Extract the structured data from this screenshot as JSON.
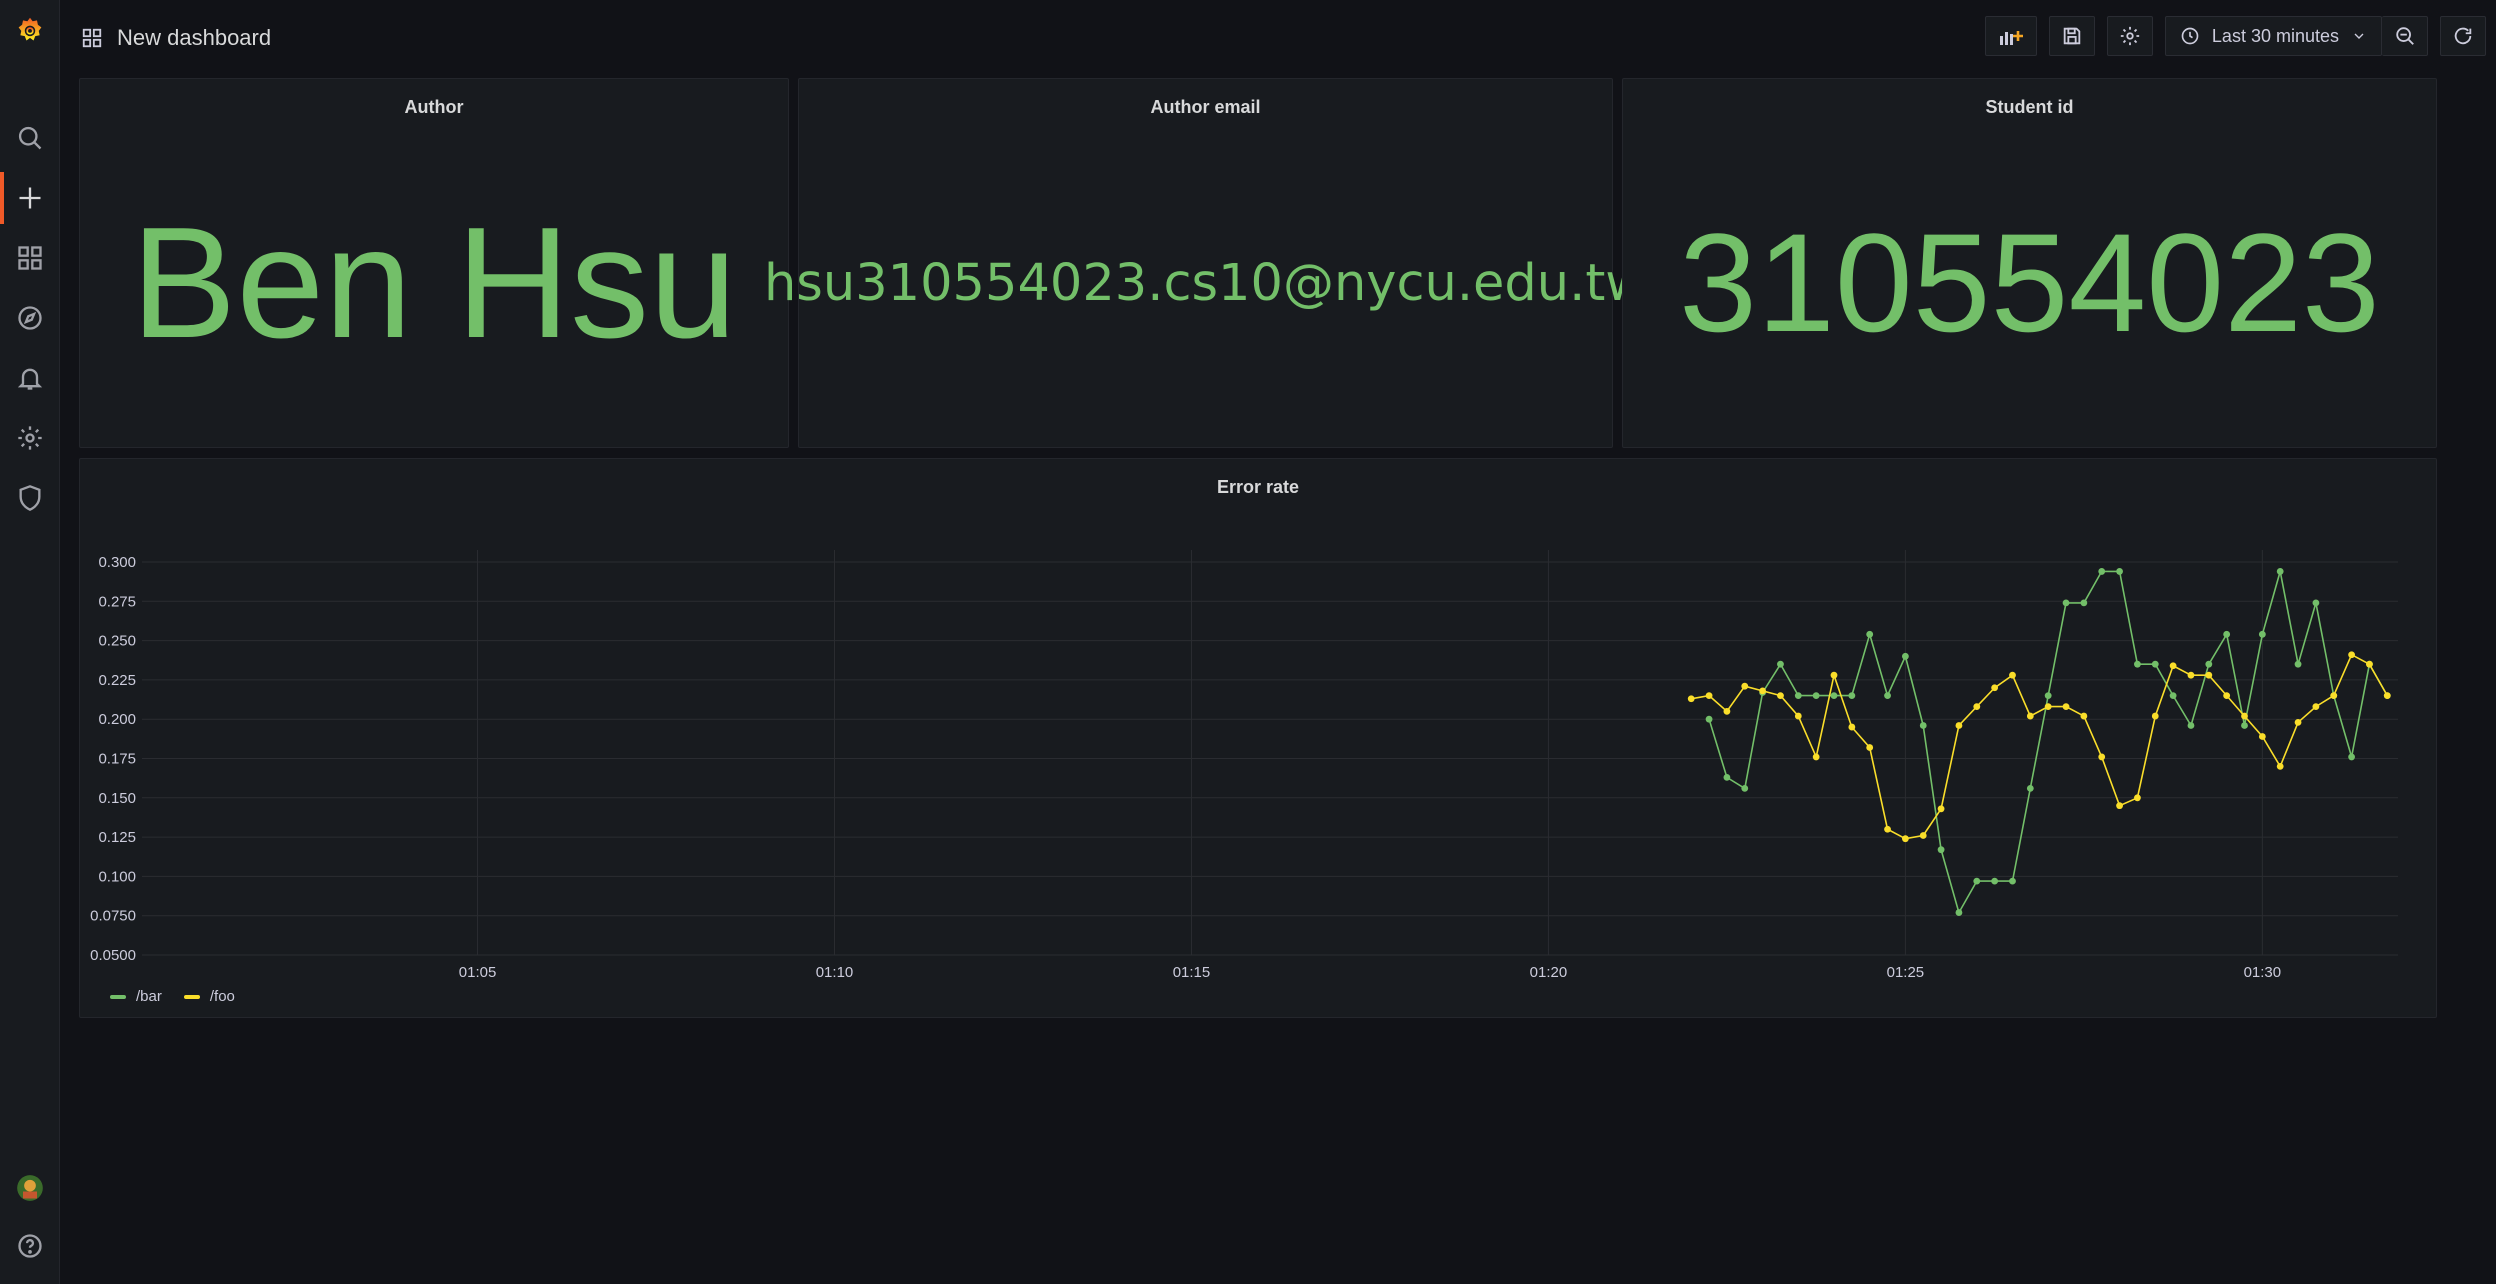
{
  "topbar": {
    "title": "New dashboard",
    "time_range": "Last 30 minutes"
  },
  "sidebar": {
    "items": [
      {
        "icon": "search-icon"
      },
      {
        "icon": "plus-icon"
      },
      {
        "icon": "dashboards-icon"
      },
      {
        "icon": "explore-icon"
      },
      {
        "icon": "alerting-bell-icon"
      },
      {
        "icon": "configuration-gear-icon"
      },
      {
        "icon": "server-admin-shield-icon"
      }
    ]
  },
  "panels": {
    "author": {
      "title": "Author",
      "value": "Ben Hsu"
    },
    "email": {
      "title": "Author email",
      "value": "hsu310554023.cs10@nycu.edu.tw"
    },
    "student": {
      "title": "Student id",
      "value": "310554023"
    }
  },
  "chart_data": {
    "type": "line",
    "title": "Error rate",
    "x_ticks": [
      "01:05",
      "01:10",
      "01:15",
      "01:20",
      "01:25",
      "01:30"
    ],
    "x_tick_values": [
      5,
      10,
      15,
      20,
      25,
      30
    ],
    "xlim": [
      0.3,
      31.9
    ],
    "y_ticks": [
      "0.0500",
      "0.0750",
      "0.100",
      "0.125",
      "0.150",
      "0.175",
      "0.200",
      "0.225",
      "0.250",
      "0.275",
      "0.300"
    ],
    "ylim": [
      0.05,
      0.3
    ],
    "grid": true,
    "legend_position": "bottom-left",
    "colors": {
      "bar": "#73bf69",
      "foo": "#fade2a"
    },
    "series": [
      {
        "name": "/bar",
        "color": "#73bf69",
        "x": [
          22.25,
          22.5,
          22.75,
          23.0,
          23.25,
          23.5,
          23.75,
          24.0,
          24.25,
          24.5,
          24.75,
          25.0,
          25.25,
          25.5,
          25.75,
          26.0,
          26.25,
          26.5,
          26.75,
          27.0,
          27.25,
          27.5,
          27.75,
          28.0,
          28.25,
          28.5,
          28.75,
          29.0,
          29.25,
          29.5,
          29.75,
          30.0,
          30.25,
          30.5,
          30.75,
          31.0,
          31.25,
          31.5,
          31.75
        ],
        "values": [
          0.2,
          0.163,
          0.156,
          0.217,
          0.235,
          0.215,
          0.215,
          0.215,
          0.215,
          0.254,
          0.215,
          0.24,
          0.196,
          0.117,
          0.077,
          0.097,
          0.097,
          0.097,
          0.156,
          0.215,
          0.274,
          0.274,
          0.294,
          0.294,
          0.235,
          0.235,
          0.215,
          0.196,
          0.235,
          0.254,
          0.196,
          0.254,
          0.294,
          0.235,
          0.274,
          0.215,
          0.176,
          0.235,
          0.215
        ]
      },
      {
        "name": "/foo",
        "color": "#fade2a",
        "x": [
          22.0,
          22.25,
          22.5,
          22.75,
          23.0,
          23.25,
          23.5,
          23.75,
          24.0,
          24.25,
          24.5,
          24.75,
          25.0,
          25.25,
          25.5,
          25.75,
          26.0,
          26.25,
          26.5,
          26.75,
          27.0,
          27.25,
          27.5,
          27.75,
          28.0,
          28.25,
          28.5,
          28.75,
          29.0,
          29.25,
          29.5,
          29.75,
          30.0,
          30.25,
          30.5,
          30.75,
          31.0,
          31.25,
          31.5,
          31.75
        ],
        "values": [
          0.213,
          0.215,
          0.205,
          0.221,
          0.218,
          0.215,
          0.202,
          0.176,
          0.228,
          0.195,
          0.182,
          0.13,
          0.124,
          0.126,
          0.143,
          0.196,
          0.208,
          0.22,
          0.228,
          0.202,
          0.208,
          0.208,
          0.202,
          0.176,
          0.145,
          0.15,
          0.202,
          0.234,
          0.228,
          0.228,
          0.215,
          0.202,
          0.189,
          0.17,
          0.198,
          0.208,
          0.215,
          0.241,
          0.235,
          0.215
        ]
      }
    ]
  }
}
